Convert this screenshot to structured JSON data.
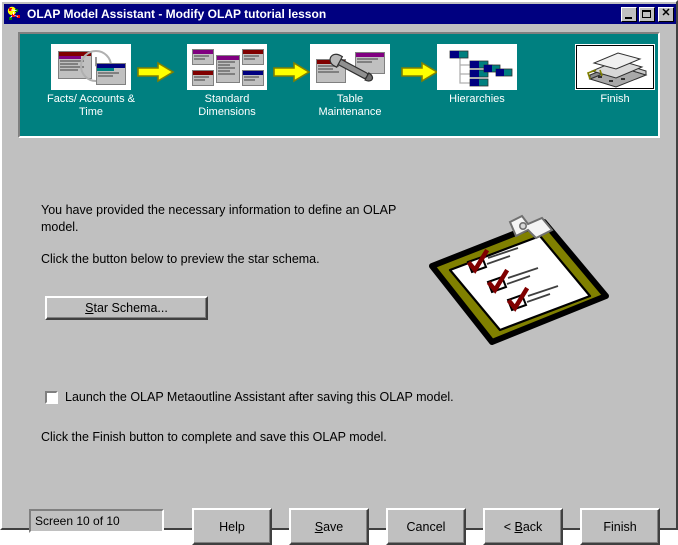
{
  "window": {
    "title": "OLAP Model Assistant - Modify OLAP tutorial lesson",
    "icon": "olap-app-icon",
    "controls": {
      "minimize": "_",
      "maximize": "□",
      "close": "✕"
    }
  },
  "banner": {
    "background_color": "#008080",
    "steps": [
      {
        "id": "facts-accounts-time",
        "label_line1": "Facts/ Accounts &",
        "label_line2": "Time",
        "icon": "tables-clock-icon",
        "active": false
      },
      {
        "id": "standard-dimensions",
        "label_line1": "Standard",
        "label_line2": "Dimensions",
        "icon": "dimension-tables-icon",
        "active": false
      },
      {
        "id": "table-maintenance",
        "label_line1": "Table",
        "label_line2": "Maintenance",
        "icon": "wrench-tables-icon",
        "active": false
      },
      {
        "id": "hierarchies",
        "label_line1": "Hierarchies",
        "label_line2": "",
        "icon": "tree-hierarchy-icon",
        "active": false
      },
      {
        "id": "finish",
        "label_line1": "Finish",
        "label_line2": "",
        "icon": "database-stack-icon",
        "active": true
      }
    ],
    "arrows": {
      "glyph": "right-arrow-icon",
      "color": "#ffff00",
      "count": 4
    }
  },
  "main": {
    "paragraph1_line1": "You have provided the necessary information to define an OLAP",
    "paragraph1_line2": "model.",
    "paragraph2": "Click the button below to preview the star schema.",
    "star_schema_button": "Star Schema...",
    "star_schema_accel": "S",
    "checkbox": {
      "label": "Launch the OLAP Metaoutline Assistant after saving this OLAP model.",
      "checked": false
    },
    "paragraph3": "Click the Finish button to complete and save this OLAP model.",
    "illustration": "clipboard-checklist-icon",
    "illustration_colors": {
      "board": "#808000",
      "paper": "#ffffff",
      "check": "#800000",
      "outline": "#000000"
    }
  },
  "footer": {
    "status": "Screen 10 of 10",
    "buttons": [
      {
        "id": "help",
        "label": "Help",
        "accel": ""
      },
      {
        "id": "save",
        "label": "Save",
        "accel": "S"
      },
      {
        "id": "cancel",
        "label": "Cancel",
        "accel": ""
      },
      {
        "id": "back",
        "label": "< Back",
        "accel": "B"
      },
      {
        "id": "finish",
        "label": "Finish",
        "accel": ""
      }
    ]
  },
  "theme": {
    "face": "#c0c0c0",
    "titlebar": "#000080",
    "titletext": "#ffffff",
    "banner": "#008080",
    "arrow": "#ffff00"
  }
}
